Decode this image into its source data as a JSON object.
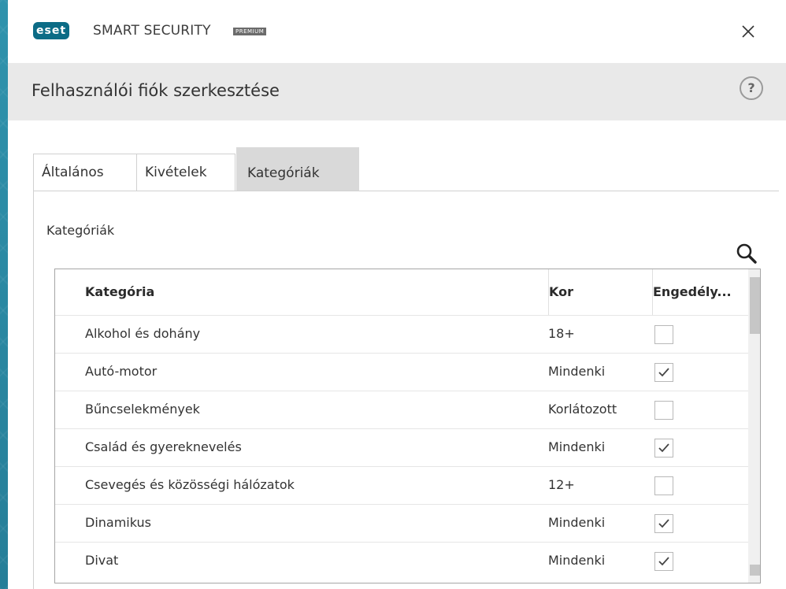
{
  "app": {
    "logo": "eset",
    "product": "SMART SECURITY",
    "badge": "PREMIUM",
    "close_icon": "close-icon"
  },
  "header": {
    "title": "Felhasználói fiók szerkesztése",
    "help_label": "?"
  },
  "tabs": [
    {
      "label": "Általános",
      "active": false
    },
    {
      "label": "Kivételek",
      "active": false
    },
    {
      "label": "Kategóriák",
      "active": true
    }
  ],
  "section": {
    "label": "Kategóriák",
    "search_icon": "search-icon"
  },
  "table": {
    "columns": [
      "Kategória",
      "Kor",
      "Engedély..."
    ],
    "rows": [
      {
        "name": "Alkohol és dohány",
        "age": "18+",
        "allowed": false
      },
      {
        "name": "Autó-motor",
        "age": "Mindenki",
        "allowed": true
      },
      {
        "name": "Bűncselekmények",
        "age": "Korlátozott",
        "allowed": false
      },
      {
        "name": "Család és gyereknevelés",
        "age": "Mindenki",
        "allowed": true
      },
      {
        "name": "Csevegés és közösségi hálózatok",
        "age": "12+",
        "allowed": false
      },
      {
        "name": "Dinamikus",
        "age": "Mindenki",
        "allowed": true
      },
      {
        "name": "Divat",
        "age": "Mindenki",
        "allowed": true
      }
    ]
  },
  "colors": {
    "brand": "#0c6c86",
    "header_band": "#e9e9e9",
    "active_tab": "#d9d9d9"
  }
}
